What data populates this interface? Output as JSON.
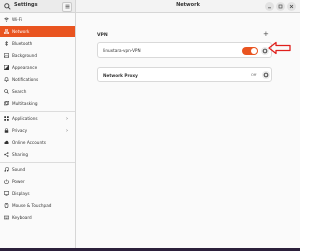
{
  "window": {
    "app_title": "Settings",
    "panel_title": "Network"
  },
  "sidebar": {
    "items": [
      {
        "label": "Wi-Fi",
        "icon": "wifi-icon"
      },
      {
        "label": "Network",
        "icon": "network-icon",
        "active": true
      },
      {
        "label": "Bluetooth",
        "icon": "bluetooth-icon"
      },
      {
        "label": "Background",
        "icon": "background-icon"
      },
      {
        "label": "Appearance",
        "icon": "appearance-icon"
      },
      {
        "label": "Notifications",
        "icon": "bell-icon"
      },
      {
        "label": "Search",
        "icon": "search-icon"
      },
      {
        "label": "Multitasking",
        "icon": "multitasking-icon"
      },
      {
        "label": "Applications",
        "icon": "applications-icon",
        "chevron": "›"
      },
      {
        "label": "Privacy",
        "icon": "lock-icon",
        "chevron": "›"
      },
      {
        "label": "Online Accounts",
        "icon": "online-accounts-icon"
      },
      {
        "label": "Sharing",
        "icon": "sharing-icon"
      },
      {
        "label": "Sound",
        "icon": "sound-icon"
      },
      {
        "label": "Power",
        "icon": "power-icon"
      },
      {
        "label": "Displays",
        "icon": "display-icon"
      },
      {
        "label": "Mouse & Touchpad",
        "icon": "mouse-icon"
      },
      {
        "label": "Keyboard",
        "icon": "keyboard-icon"
      }
    ]
  },
  "main": {
    "vpn_heading": "VPN",
    "add_symbol": "+",
    "vpn_connection": {
      "name": "linuxtara-vpn-VPN",
      "enabled": true
    },
    "proxy": {
      "label": "Network Proxy",
      "status": "Off"
    }
  },
  "colors": {
    "accent": "#e95420",
    "annotation": "#e0201c"
  }
}
